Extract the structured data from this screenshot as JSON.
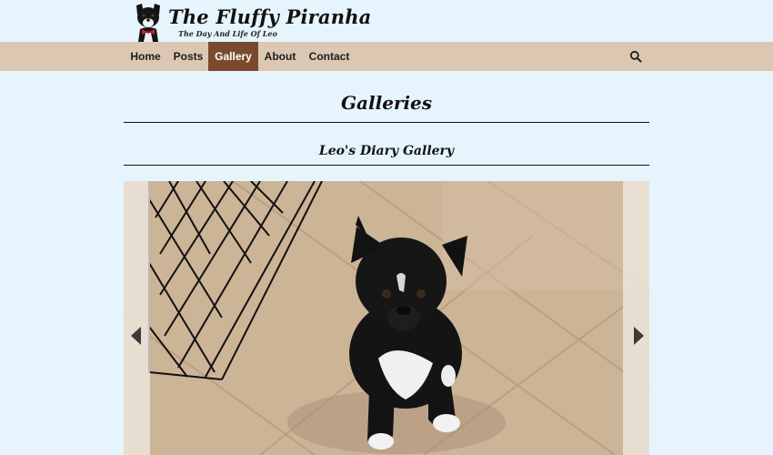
{
  "site": {
    "title": "The Fluffy Piranha",
    "tagline": "The Day And Life Of Leo"
  },
  "nav": {
    "items": [
      {
        "label": "Home",
        "active": false
      },
      {
        "label": "Posts",
        "active": false
      },
      {
        "label": "Gallery",
        "active": true
      },
      {
        "label": "About",
        "active": false
      },
      {
        "label": "Contact",
        "active": false
      }
    ],
    "search_icon": "search-icon"
  },
  "main": {
    "page_title": "Galleries",
    "gallery_title": "Leo's Diary Gallery"
  },
  "slider": {
    "prev_icon": "triangle-left",
    "next_icon": "triangle-right",
    "photo": "puppy-photo"
  },
  "colors": {
    "background": "#e6f4fd",
    "nav_background": "#dcc7b3",
    "nav_active": "#7a4a2c"
  }
}
